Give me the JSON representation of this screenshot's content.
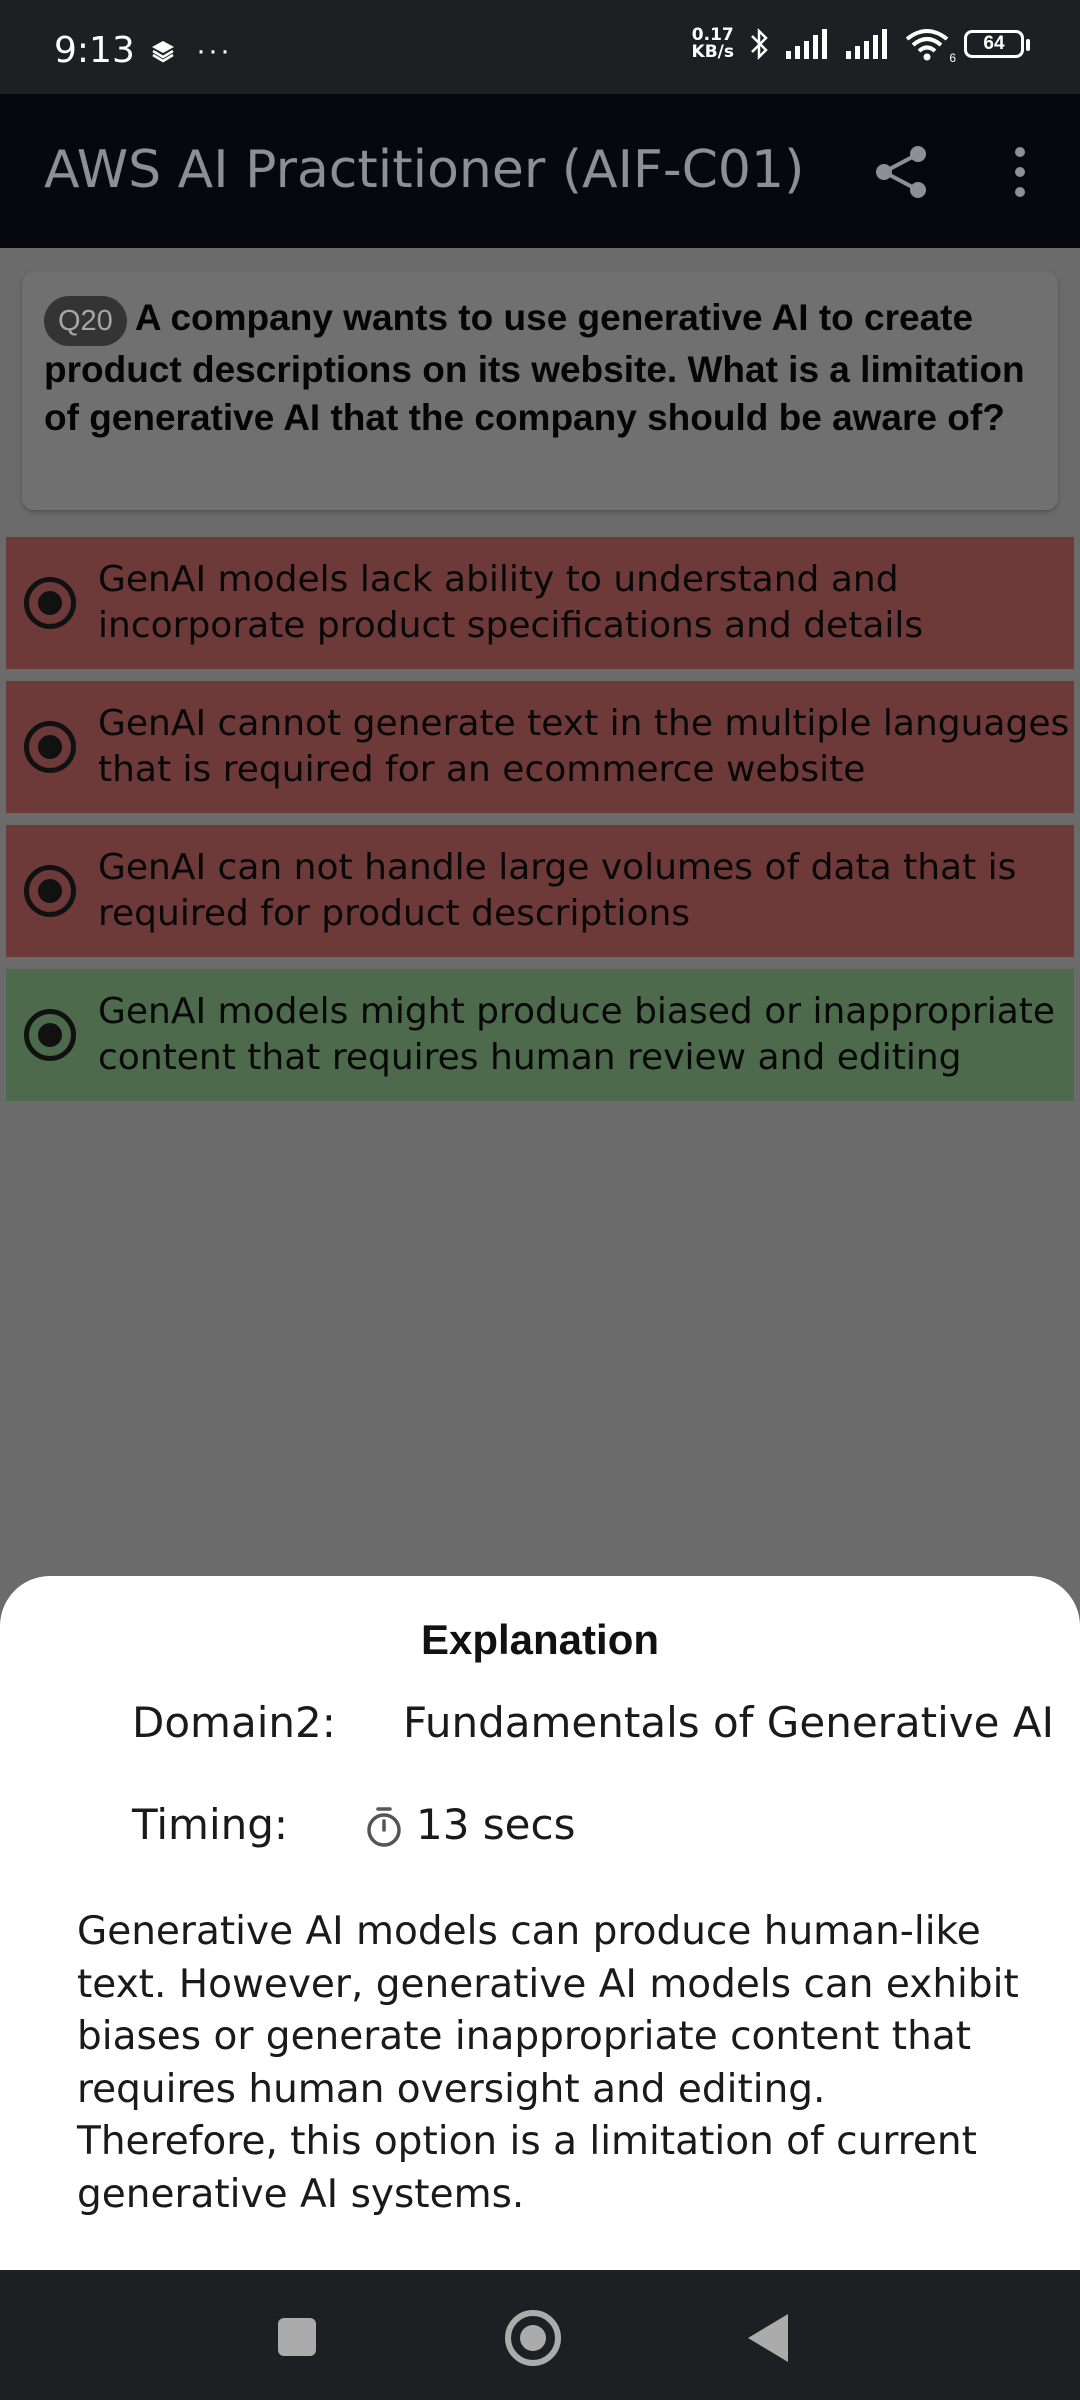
{
  "status_bar": {
    "time": "9:13",
    "overflow": "···",
    "net_speed_value": "0.17",
    "net_speed_unit": "KB/s",
    "wifi_badge": "6",
    "battery": "64"
  },
  "app_bar": {
    "title": "AWS AI Practitioner (AIF-C01)"
  },
  "question": {
    "badge": "Q20",
    "text": "A company wants to use generative AI to create product descriptions on its website. What is a limitation of generative AI that the company should be aware of?"
  },
  "options": [
    {
      "text": "GenAI models lack ability to understand and incorporate product specifications and details",
      "status": "wrong"
    },
    {
      "text": "GenAI cannot generate text in the multiple languages that is required for an ecommerce website",
      "status": "wrong"
    },
    {
      "text": "GenAI can not handle large volumes of data that is required for product descriptions",
      "status": "wrong"
    },
    {
      "text": "GenAI models might produce biased or inappropriate content that requires human review and editing",
      "status": "correct"
    }
  ],
  "explanation": {
    "title": "Explanation",
    "domain_label": "Domain2:",
    "domain_value": "Fundamentals of Generative AI",
    "timing_label": "Timing:",
    "timing_value": "13 secs",
    "body": "Generative AI models can produce human-like text. However, generative AI models can exhibit biases or generate inappropriate content that requires human oversight and editing. Therefore, this option is a limitation of current generative AI systems."
  },
  "icons": {
    "share": "share-icon",
    "menu": "more-vert-icon",
    "timer": "stopwatch-icon",
    "nav_recents": "square-icon",
    "nav_home": "circle-icon",
    "nav_back": "triangle-back-icon"
  },
  "colors": {
    "wrong": "#6e3939",
    "correct": "#4d6a4d",
    "app_bar": "#05090f",
    "scrim": "#6b6b6b"
  }
}
